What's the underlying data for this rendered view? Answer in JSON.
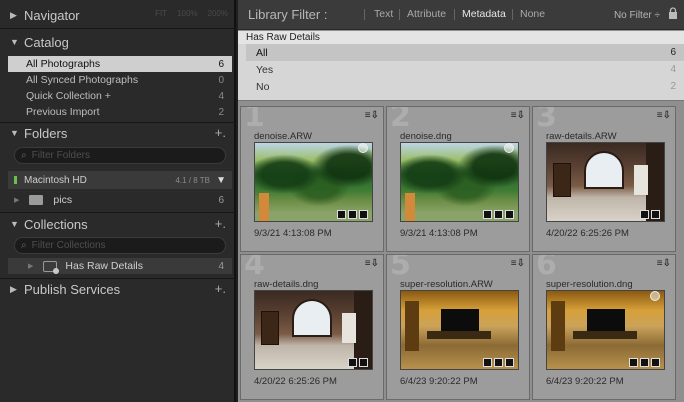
{
  "left": {
    "navigator": {
      "label": "Navigator",
      "zoom_options": [
        "FIT",
        "100%",
        "200%"
      ]
    },
    "catalog": {
      "label": "Catalog",
      "items": [
        {
          "label": "All Photographs",
          "count": "6",
          "selected": true
        },
        {
          "label": "All Synced Photographs",
          "count": "0"
        },
        {
          "label": "Quick Collection  +",
          "count": "4"
        },
        {
          "label": "Previous Import",
          "count": "2"
        }
      ]
    },
    "folders": {
      "label": "Folders",
      "filter_placeholder": "Filter Folders",
      "volume": {
        "name": "Macintosh HD",
        "capacity": "4.1 / 8 TB"
      },
      "items": [
        {
          "label": "pics",
          "count": "6"
        }
      ]
    },
    "collections": {
      "label": "Collections",
      "filter_placeholder": "Filter Collections",
      "items": [
        {
          "label": "Has Raw Details",
          "count": "4"
        }
      ]
    },
    "publish": {
      "label": "Publish Services"
    }
  },
  "filterbar": {
    "title": "Library Filter :",
    "options": [
      "Text",
      "Attribute",
      "Metadata",
      "None"
    ],
    "active": "Metadata",
    "preset": "No Filter ÷"
  },
  "metadata_panel": {
    "header": "Has Raw Details",
    "rows": [
      {
        "label": "All",
        "count": "6",
        "selected": true
      },
      {
        "label": "Yes",
        "count": "4"
      },
      {
        "label": "No",
        "count": "2"
      }
    ]
  },
  "grid": [
    {
      "num": "1",
      "name": "denoise.ARW",
      "date": "9/3/21 4:13:08 PM",
      "scene": "forest"
    },
    {
      "num": "2",
      "name": "denoise.dng",
      "date": "9/3/21 4:13:08 PM",
      "scene": "forest"
    },
    {
      "num": "3",
      "name": "raw-details.ARW",
      "date": "4/20/22 6:25:26 PM",
      "scene": "room"
    },
    {
      "num": "4",
      "name": "raw-details.dng",
      "date": "4/20/22 6:25:26 PM",
      "scene": "room"
    },
    {
      "num": "5",
      "name": "super-resolution.ARW",
      "date": "6/4/23 9:20:22 PM",
      "scene": "amber"
    },
    {
      "num": "6",
      "name": "super-resolution.dng",
      "date": "6/4/23 9:20:22 PM",
      "scene": "amber"
    }
  ],
  "colors": {
    "selected_row": "#cfcfcf",
    "panel_bg": "#2a2a2a",
    "grid_bg": "#8f8f8f",
    "volume_led": "#6bbf4e"
  }
}
